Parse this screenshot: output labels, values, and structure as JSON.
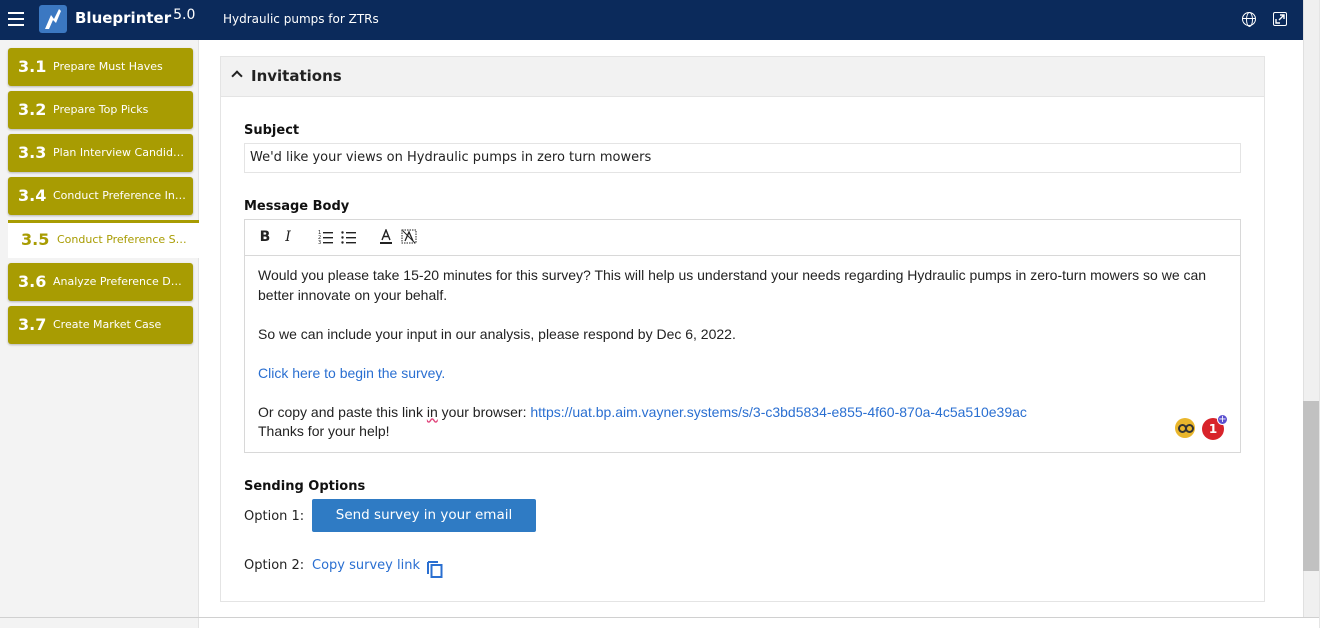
{
  "app": {
    "brand": "Blueprinter",
    "version": "5.0",
    "project_title": "Hydraulic pumps for ZTRs"
  },
  "sidebar": {
    "steps": [
      {
        "num": "3.1",
        "label": "Prepare Must Haves",
        "active": false
      },
      {
        "num": "3.2",
        "label": "Prepare Top Picks",
        "active": false
      },
      {
        "num": "3.3",
        "label": "Plan Interview Candida...",
        "active": false
      },
      {
        "num": "3.4",
        "label": "Conduct Preference Int...",
        "active": false
      },
      {
        "num": "3.5",
        "label": "Conduct Preference Sur...",
        "active": true
      },
      {
        "num": "3.6",
        "label": "Analyze Preference Data",
        "active": false
      },
      {
        "num": "3.7",
        "label": "Create Market Case",
        "active": false
      }
    ],
    "accent_color": "#a89c02"
  },
  "invitations": {
    "title": "Invitations",
    "subject_label": "Subject",
    "subject_value": "We'd like your views on Hydraulic pumps in zero turn mowers",
    "message_label": "Message Body",
    "toolbar": {
      "bold": "B",
      "italic": "I"
    },
    "body": {
      "line1": "Would you please take 15-20 minutes for this survey? This will help us understand your needs regarding Hydraulic pumps in zero-turn mowers so we can better innovate on your behalf.",
      "line2": "So we can include your input in our analysis, please respond by Dec 6, 2022.",
      "survey_link_text": "Click here to begin the survey.",
      "copy_prefix_a": "Or copy and paste this link ",
      "copy_prefix_in": "in",
      "copy_prefix_b": " your browser: ",
      "survey_url": "https://uat.bp.aim.vayner.systems/s/3-c3bd5834-e855-4f60-870a-4c5a510e39ac",
      "thanks": "Thanks for your help!"
    },
    "notification_count": "1",
    "sending_options_label": "Sending Options",
    "option1_label": "Option 1:",
    "option1_button": "Send survey in your email",
    "option2_label": "Option 2:",
    "option2_link": "Copy survey link"
  },
  "colors": {
    "topbar": "#0b2a5b",
    "primary_button": "#2f7bc4",
    "link": "#2a6fd1"
  }
}
